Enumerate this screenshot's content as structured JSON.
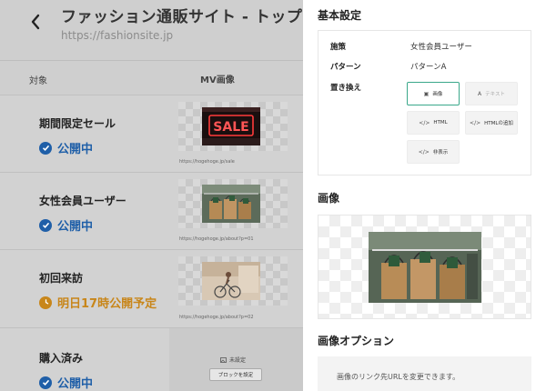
{
  "header": {
    "title": "ファッション通販サイト - トップ",
    "url": "https://fashionsite.jp"
  },
  "table": {
    "col_target": "対象",
    "col_mv": "MV画像",
    "rows": [
      {
        "name": "期間限定セール",
        "status": "公開中",
        "link": "https://hogehoge.jp/sale"
      },
      {
        "name": "女性会員ユーザー",
        "status": "公開中",
        "link": "https://hogehoge.jp/about?p=01"
      },
      {
        "name": "初回来訪",
        "status": "明日17時公開予定",
        "link": "https://hogehoge.jp/about?p=02"
      },
      {
        "name": "購入済み",
        "status": "公開中",
        "unset_label": "未設定",
        "block_button": "ブロックを設定"
      }
    ],
    "sale_sign": "SALE"
  },
  "panel": {
    "basic_title": "基本設定",
    "measure_label": "施策",
    "measure_value": "女性会員ユーザー",
    "pattern_label": "パターン",
    "pattern_value": "パターンA",
    "replace_label": "置き換え",
    "options": {
      "image": "画像",
      "text": "テキスト",
      "html": "HTML",
      "html_add": "HTMLの追加",
      "hide": "非表示"
    },
    "image_title": "画像",
    "image_options_title": "画像オプション",
    "image_options_text": "画像のリンク先URLを変更できます。"
  },
  "colors": {
    "published": "#1f5fa8",
    "scheduled": "#c8861a",
    "selected_border": "#3aa88a",
    "dim_overlay": "#cfcfcf"
  },
  "icons": [
    "back-chevron-icon",
    "check-circle-icon",
    "clock-icon",
    "image-icon",
    "text-icon",
    "code-icon",
    "hide-icon"
  ]
}
